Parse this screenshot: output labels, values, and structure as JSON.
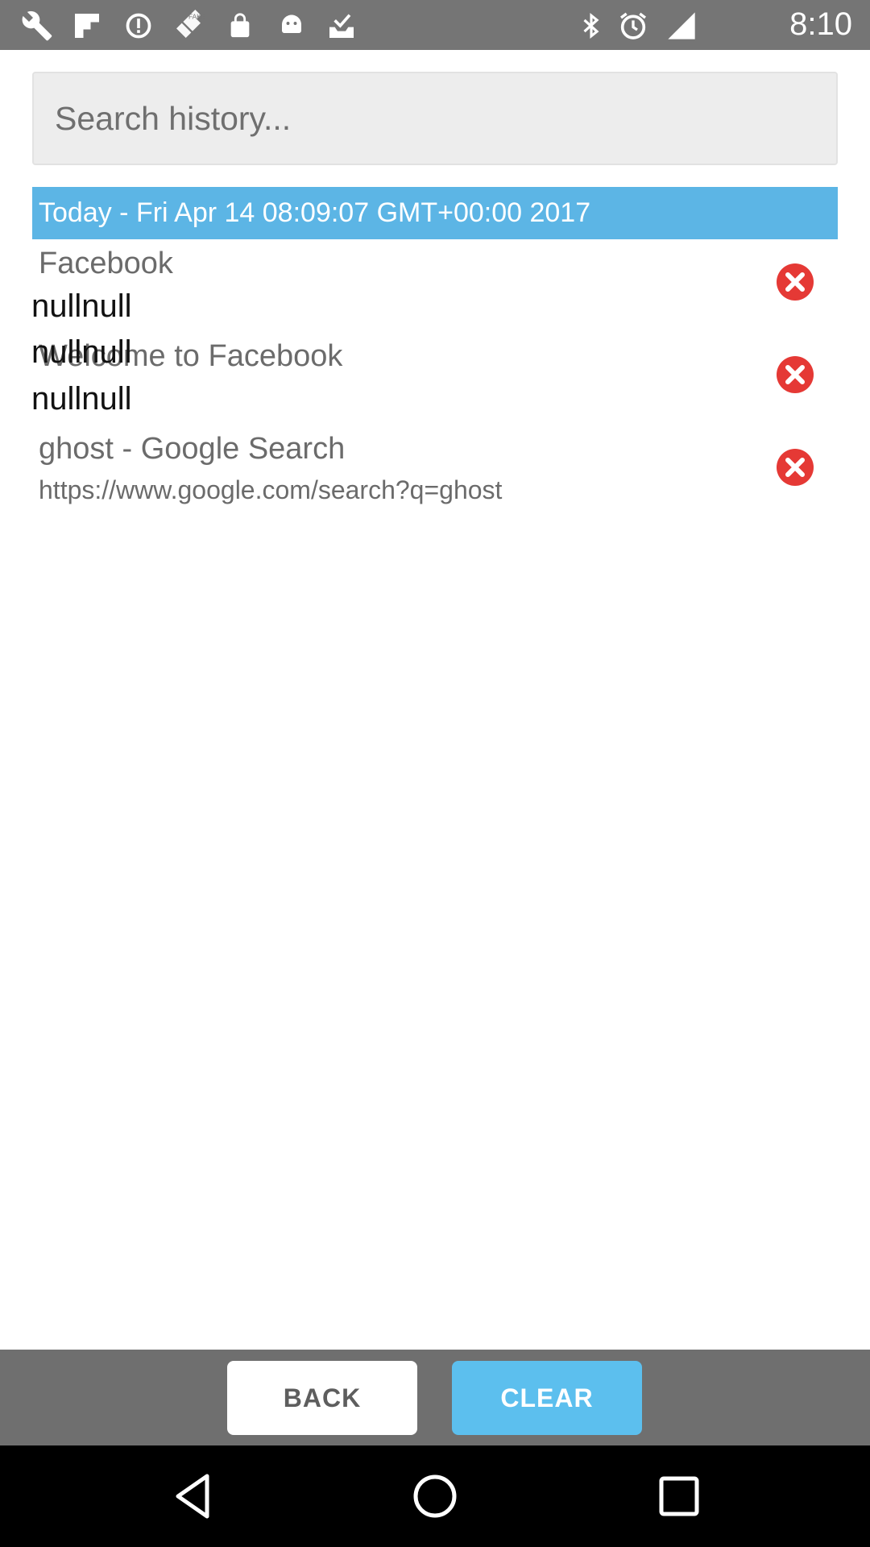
{
  "status_bar": {
    "time": "8:10",
    "left_icons": [
      "wrench-icon",
      "flipboard-icon",
      "data-saver-icon",
      "fake-gps-icon",
      "lock-icon",
      "android-icon",
      "download-done-icon"
    ],
    "right_icons": [
      "bluetooth-icon",
      "alarm-icon",
      "signal-icon"
    ]
  },
  "search": {
    "placeholder": "Search history...",
    "value": ""
  },
  "history": {
    "date_header": "Today - Fri Apr 14 08:09:07 GMT+00:00 2017",
    "items": [
      {
        "title": "Facebook",
        "subtitle": "nullnull"
      },
      {
        "title": "Welcome to Facebook",
        "subtitle": "nullnull",
        "overlap_text": "nullnull"
      },
      {
        "title": "ghost - Google Search",
        "subtitle": "https://www.google.com/search?q=ghost"
      }
    ]
  },
  "buttons": {
    "back": "BACK",
    "clear": "CLEAR"
  },
  "colors": {
    "accent": "#5cb5e5",
    "clear_button": "#5cbfee",
    "delete_icon": "#e53935",
    "status_bar": "#757575",
    "bottom_bar": "#6f6f6f"
  },
  "nav_bar": [
    "back-triangle-icon",
    "home-circle-icon",
    "recents-square-icon"
  ]
}
